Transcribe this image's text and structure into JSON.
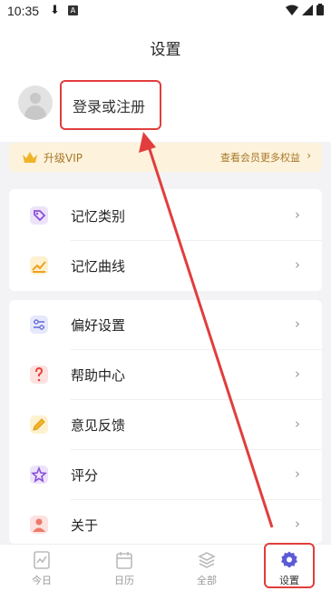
{
  "status_bar": {
    "time": "10:35"
  },
  "header": {
    "title": "设置"
  },
  "profile": {
    "login_label": "登录或注册"
  },
  "vip": {
    "label": "升级VIP",
    "link": "查看会员更多权益"
  },
  "menu_group_1": [
    {
      "label": "记忆类别",
      "icon": "tag-icon"
    },
    {
      "label": "记忆曲线",
      "icon": "chart-icon"
    }
  ],
  "menu_group_2": [
    {
      "label": "偏好设置",
      "icon": "sliders-icon"
    },
    {
      "label": "帮助中心",
      "icon": "question-icon"
    },
    {
      "label": "意见反馈",
      "icon": "pencil-icon"
    },
    {
      "label": "评分",
      "icon": "star-icon"
    },
    {
      "label": "关于",
      "icon": "person-icon"
    }
  ],
  "tabs": [
    {
      "label": "今日",
      "icon": "today-icon",
      "active": false
    },
    {
      "label": "日历",
      "icon": "calendar-icon",
      "active": false
    },
    {
      "label": "全部",
      "icon": "layers-icon",
      "active": false
    },
    {
      "label": "设置",
      "icon": "gear-icon",
      "active": true
    }
  ],
  "colors": {
    "accent": "#5b5bd6",
    "vip_text": "#a8772a",
    "vip_bg": "#fdf3dc",
    "annotation": "#e23d3d"
  }
}
